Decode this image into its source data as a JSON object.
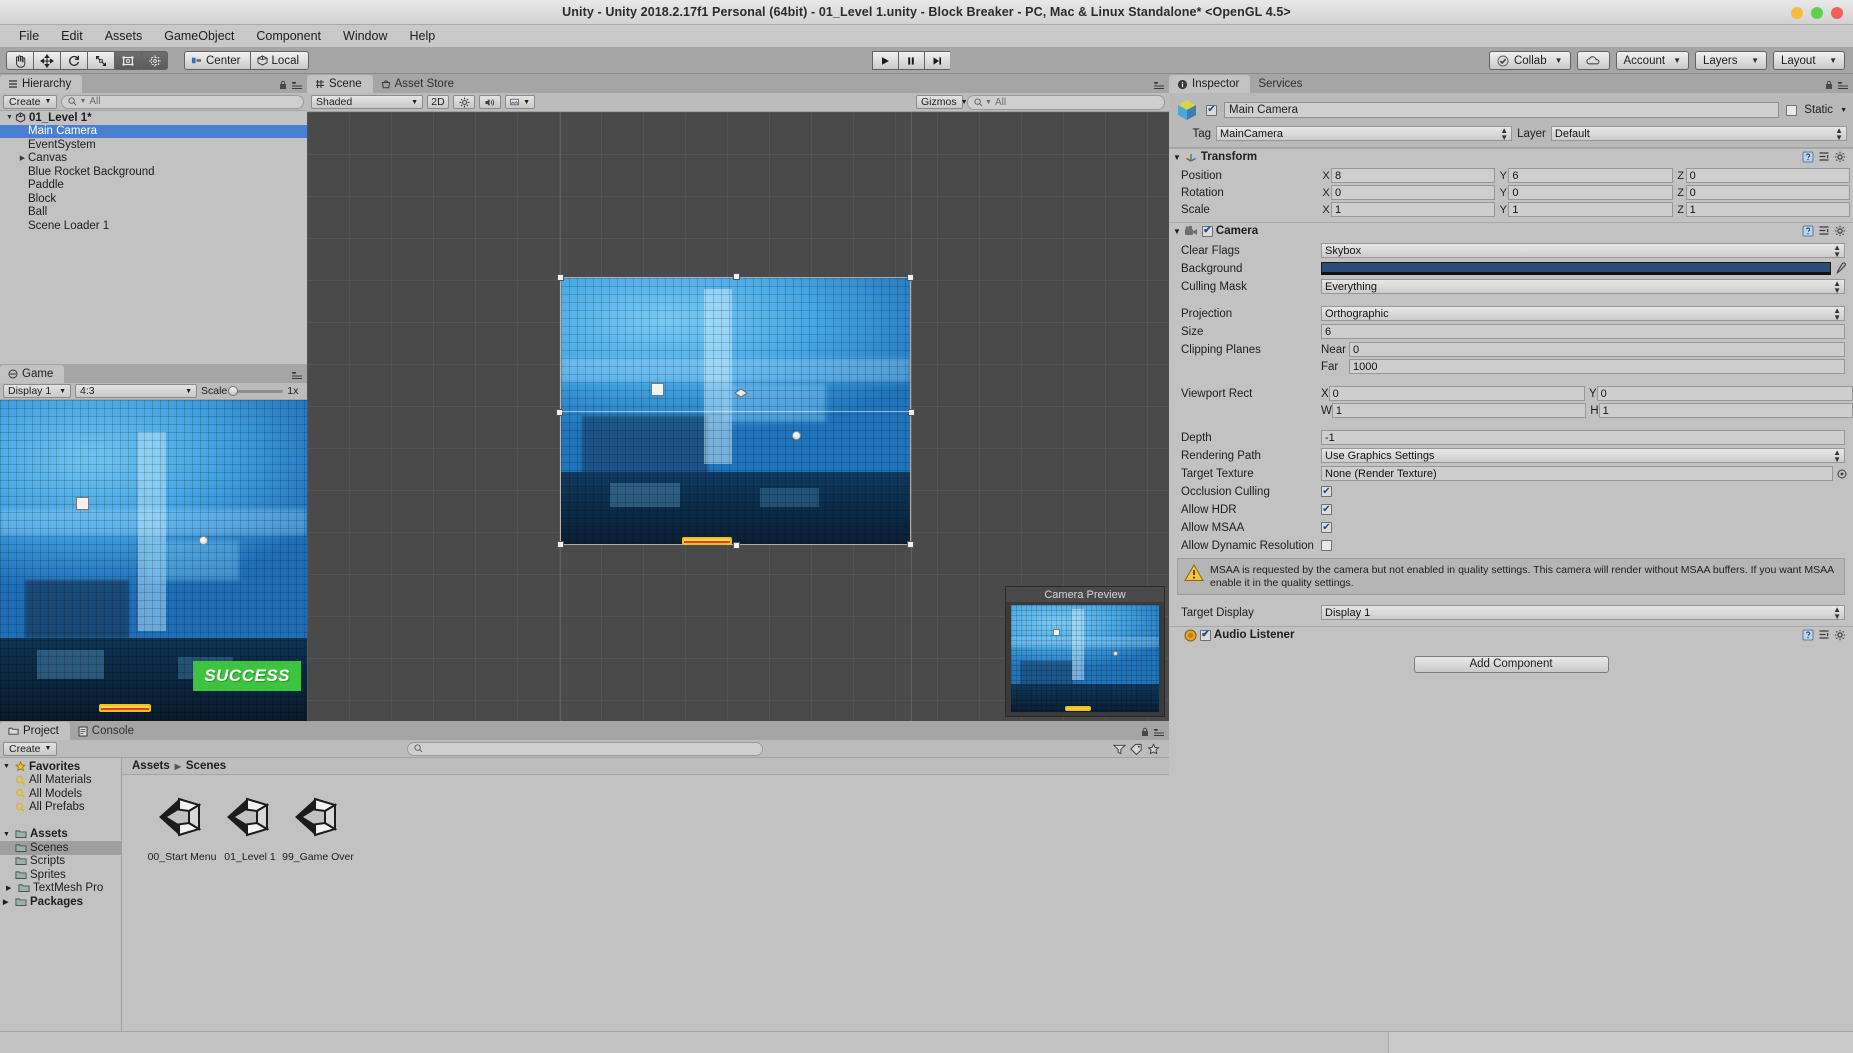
{
  "window": {
    "title": "Unity - Unity 2018.2.17f1 Personal (64bit) - 01_Level 1.unity - Block Breaker - PC, Mac & Linux Standalone* <OpenGL 4.5>",
    "buttons": [
      "minimize",
      "maximize",
      "close"
    ]
  },
  "menubar": {
    "items": [
      "File",
      "Edit",
      "Assets",
      "GameObject",
      "Component",
      "Window",
      "Help"
    ]
  },
  "toolbar": {
    "tools": [
      "hand-tool",
      "move-tool",
      "rotate-tool",
      "scale-tool",
      "rect-tool",
      "transform-tool"
    ],
    "active_tool_index": 4,
    "pivot_mode": "Center",
    "pivot_rotation": "Local",
    "play": "play",
    "pause": "pause",
    "step": "step",
    "collab": "Collab",
    "cloud": "cloud-icon",
    "account": "Account",
    "layers": "Layers",
    "layout": "Layout"
  },
  "hierarchy": {
    "tab": "Hierarchy",
    "create_label": "Create",
    "search_placeholder": "All",
    "scene_name": "01_Level 1*",
    "items": [
      {
        "label": "Main Camera",
        "indent": 1,
        "selected": true,
        "expandable": false
      },
      {
        "label": "EventSystem",
        "indent": 1,
        "selected": false,
        "expandable": false
      },
      {
        "label": "Canvas",
        "indent": 1,
        "selected": false,
        "expandable": true
      },
      {
        "label": "Blue Rocket Background",
        "indent": 1,
        "selected": false,
        "expandable": false
      },
      {
        "label": "Paddle",
        "indent": 1,
        "selected": false,
        "expandable": false
      },
      {
        "label": "Block",
        "indent": 1,
        "selected": false,
        "expandable": false
      },
      {
        "label": "Ball",
        "indent": 1,
        "selected": false,
        "expandable": false
      },
      {
        "label": "Scene Loader 1",
        "indent": 1,
        "selected": false,
        "expandable": false
      }
    ]
  },
  "scene_panel": {
    "tabs": [
      {
        "label": "Scene",
        "active": true,
        "icon": "scene-icon"
      },
      {
        "label": "Asset Store",
        "active": false,
        "icon": "store-icon"
      }
    ],
    "draw_mode": "Shaded",
    "mode_2d": "2D",
    "lighting_icon": "sun-icon",
    "audio_icon": "speaker-icon",
    "fx_icon": "image-icon",
    "gizmos": "Gizmos",
    "search_placeholder": "All",
    "camera_preview_label": "Camera Preview"
  },
  "game_panel": {
    "tab": "Game",
    "display": "Display 1",
    "aspect": "4:3",
    "scale_label": "Scale",
    "scale_value": "1x",
    "overlay_text": "SUCCESS"
  },
  "inspector": {
    "tabs": [
      {
        "label": "Inspector",
        "active": true,
        "icon": "info-icon"
      },
      {
        "label": "Services",
        "active": false,
        "icon": "services-icon"
      }
    ],
    "object_name": "Main Camera",
    "object_enabled": true,
    "static_label": "Static",
    "static_checked": false,
    "tag_label": "Tag",
    "tag_value": "MainCamera",
    "layer_label": "Layer",
    "layer_value": "Default",
    "transform": {
      "title": "Transform",
      "position_label": "Position",
      "position": {
        "x": "8",
        "y": "6",
        "z": "0"
      },
      "rotation_label": "Rotation",
      "rotation": {
        "x": "0",
        "y": "0",
        "z": "0"
      },
      "scale_label": "Scale",
      "scale": {
        "x": "1",
        "y": "1",
        "z": "1"
      }
    },
    "camera": {
      "title": "Camera",
      "enabled": true,
      "clear_flags_label": "Clear Flags",
      "clear_flags": "Skybox",
      "background_label": "Background",
      "background_color": "#2d4b78",
      "culling_mask_label": "Culling Mask",
      "culling_mask": "Everything",
      "projection_label": "Projection",
      "projection": "Orthographic",
      "size_label": "Size",
      "size": "6",
      "clipping_label": "Clipping Planes",
      "near_label": "Near",
      "near": "0",
      "far_label": "Far",
      "far": "1000",
      "viewport_label": "Viewport Rect",
      "viewport": {
        "x": "0",
        "y": "0",
        "w": "1",
        "h": "1"
      },
      "depth_label": "Depth",
      "depth": "-1",
      "rendering_path_label": "Rendering Path",
      "rendering_path": "Use Graphics Settings",
      "target_texture_label": "Target Texture",
      "target_texture": "None (Render Texture)",
      "occlusion_label": "Occlusion Culling",
      "occlusion": true,
      "hdr_label": "Allow HDR",
      "hdr": true,
      "msaa_label": "Allow MSAA",
      "msaa": true,
      "dynamic_res_label": "Allow Dynamic Resolution",
      "dynamic_res": false,
      "warning": "MSAA is requested by the camera but not enabled in quality settings. This camera will render without MSAA buffers. If you want MSAA enable it in the quality settings.",
      "target_display_label": "Target Display",
      "target_display": "Display 1"
    },
    "audio_listener": {
      "title": "Audio Listener",
      "enabled": true
    },
    "add_component": "Add Component"
  },
  "project": {
    "tabs": [
      {
        "label": "Project",
        "active": true,
        "icon": "folder-icon"
      },
      {
        "label": "Console",
        "active": false,
        "icon": "console-icon"
      }
    ],
    "create_label": "Create",
    "search_placeholder": "",
    "tree": [
      {
        "label": "Favorites",
        "icon": "star-icon",
        "indent": 0,
        "bold": true,
        "arrow": "down",
        "selected": false
      },
      {
        "label": "All Materials",
        "icon": "search-icon",
        "indent": 1,
        "bold": false,
        "arrow": "",
        "selected": false
      },
      {
        "label": "All Models",
        "icon": "search-icon",
        "indent": 1,
        "bold": false,
        "arrow": "",
        "selected": false
      },
      {
        "label": "All Prefabs",
        "icon": "search-icon",
        "indent": 1,
        "bold": false,
        "arrow": "",
        "selected": false
      },
      {
        "label": "",
        "icon": "",
        "indent": 0,
        "bold": false,
        "arrow": "",
        "selected": false
      },
      {
        "label": "Assets",
        "icon": "folder-icon",
        "indent": 0,
        "bold": true,
        "arrow": "down",
        "selected": false
      },
      {
        "label": "Scenes",
        "icon": "folder-icon",
        "indent": 1,
        "bold": false,
        "arrow": "",
        "selected": true
      },
      {
        "label": "Scripts",
        "icon": "folder-icon",
        "indent": 1,
        "bold": false,
        "arrow": "",
        "selected": false
      },
      {
        "label": "Sprites",
        "icon": "folder-icon",
        "indent": 1,
        "bold": false,
        "arrow": "",
        "selected": false
      },
      {
        "label": "TextMesh Pro",
        "icon": "folder-icon",
        "indent": 1,
        "bold": false,
        "arrow": "right",
        "selected": false
      },
      {
        "label": "Packages",
        "icon": "folder-icon",
        "indent": 0,
        "bold": true,
        "arrow": "right",
        "selected": false
      }
    ],
    "breadcrumb": [
      "Assets",
      "Scenes"
    ],
    "assets": [
      {
        "name": "00_Start Menu",
        "icon": "unity-scene-icon"
      },
      {
        "name": "01_Level 1",
        "icon": "unity-scene-icon"
      },
      {
        "name": "99_Game Over",
        "icon": "unity-scene-icon"
      }
    ]
  },
  "colors": {
    "selection_blue": "#4b7fd1",
    "success_green": "#3cc43f",
    "panel_gray": "#c2c2c2",
    "toolbar_gray": "#a5a5a5"
  }
}
